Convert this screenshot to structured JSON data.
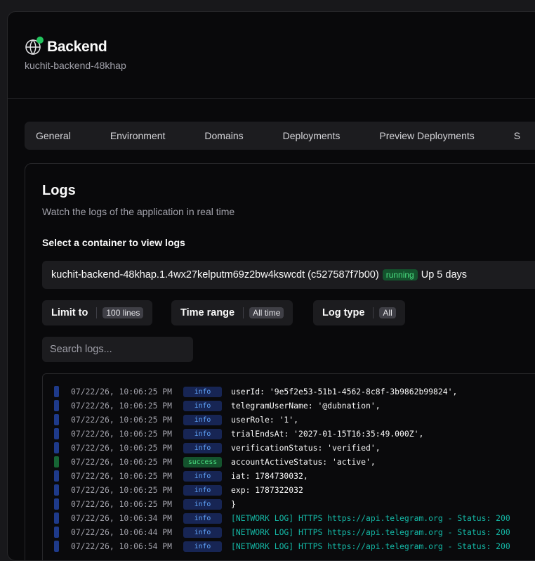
{
  "app": {
    "title": "Backend",
    "subtitle": "kuchit-backend-48khap",
    "status_color": "#22c55e"
  },
  "tabs": [
    "General",
    "Environment",
    "Domains",
    "Deployments",
    "Preview Deployments",
    "S"
  ],
  "logs_card": {
    "title": "Logs",
    "description": "Watch the logs of the application in real time",
    "select_label": "Select a container to view logs",
    "container": {
      "name": "kuchit-backend-48khap.1.4wx27kelputm69z2bw4kswcdt (c527587f7b00)",
      "state": "running",
      "uptime": "Up 5 days"
    },
    "filters": {
      "limit": {
        "label": "Limit to",
        "value": "100 lines"
      },
      "time_range": {
        "label": "Time range",
        "value": "All time"
      },
      "log_type": {
        "label": "Log type",
        "value": "All"
      }
    },
    "search_placeholder": "Search logs...",
    "level_colors": {
      "info": {
        "bar": "#1e3a8a",
        "bg": "#172554",
        "fg": "#60a5fa"
      },
      "success": {
        "bar": "#166534",
        "bg": "#14532d",
        "fg": "#4ade80"
      }
    },
    "log_lines": [
      {
        "timestamp": "07/22/26, 10:06:25 PM",
        "level": "info",
        "message": "userId: '9e5f2e53-51b1-4562-8c8f-3b9862b99824',"
      },
      {
        "timestamp": "07/22/26, 10:06:25 PM",
        "level": "info",
        "message": "telegramUserName: '@dubnation',"
      },
      {
        "timestamp": "07/22/26, 10:06:25 PM",
        "level": "info",
        "message": "userRole: '1',"
      },
      {
        "timestamp": "07/22/26, 10:06:25 PM",
        "level": "info",
        "message": "trialEndsAt: '2027-01-15T16:35:49.000Z',"
      },
      {
        "timestamp": "07/22/26, 10:06:25 PM",
        "level": "info",
        "message": "verificationStatus: 'verified',"
      },
      {
        "timestamp": "07/22/26, 10:06:25 PM",
        "level": "success",
        "message": "accountActiveStatus: 'active',"
      },
      {
        "timestamp": "07/22/26, 10:06:25 PM",
        "level": "info",
        "message": "iat: 1784730032,"
      },
      {
        "timestamp": "07/22/26, 10:06:25 PM",
        "level": "info",
        "message": "exp: 1787322032"
      },
      {
        "timestamp": "07/22/26, 10:06:25 PM",
        "level": "info",
        "message": "}"
      },
      {
        "timestamp": "07/22/26, 10:06:34 PM",
        "level": "info",
        "message": "[NETWORK LOG] HTTPS https://api.telegram.org - Status: 200",
        "network": true
      },
      {
        "timestamp": "07/22/26, 10:06:44 PM",
        "level": "info",
        "message": "[NETWORK LOG] HTTPS https://api.telegram.org - Status: 200",
        "network": true
      },
      {
        "timestamp": "07/22/26, 10:06:54 PM",
        "level": "info",
        "message": "[NETWORK LOG] HTTPS https://api.telegram.org - Status: 200",
        "network": true
      }
    ]
  }
}
